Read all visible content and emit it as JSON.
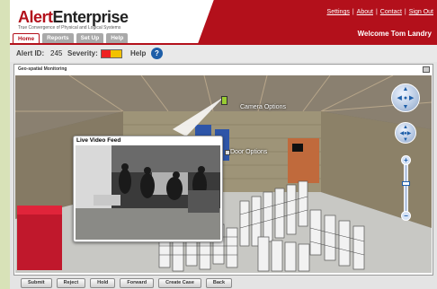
{
  "app": {
    "logo_alert": "Alert",
    "logo_enterprise": "Enterprise",
    "tagline": "True Convergence of Physical and Logical Systems",
    "brand_color": "#b3101b"
  },
  "toplinks": [
    "Settings",
    "About",
    "Contact",
    "Sign Out"
  ],
  "welcome": "Welcome Tom Landry",
  "tabs": [
    {
      "label": "Home",
      "active": true
    },
    {
      "label": "Reports",
      "active": false
    },
    {
      "label": "Set Up",
      "active": false
    },
    {
      "label": "Help",
      "active": false
    }
  ],
  "alert": {
    "id_label": "Alert ID:",
    "id_value": "245",
    "severity_label": "Severity:",
    "severity_level": 0.45,
    "help_label": "Help",
    "help_icon": "question-icon"
  },
  "panel": {
    "title": "Geo-spatial Monitoring",
    "camera_label": "Camera Options",
    "door_label": "Door Options",
    "video_title": "Live Video Feed"
  },
  "buttons": [
    "Submit",
    "Reject",
    "Hold",
    "Forward",
    "Create Case",
    "Back"
  ]
}
